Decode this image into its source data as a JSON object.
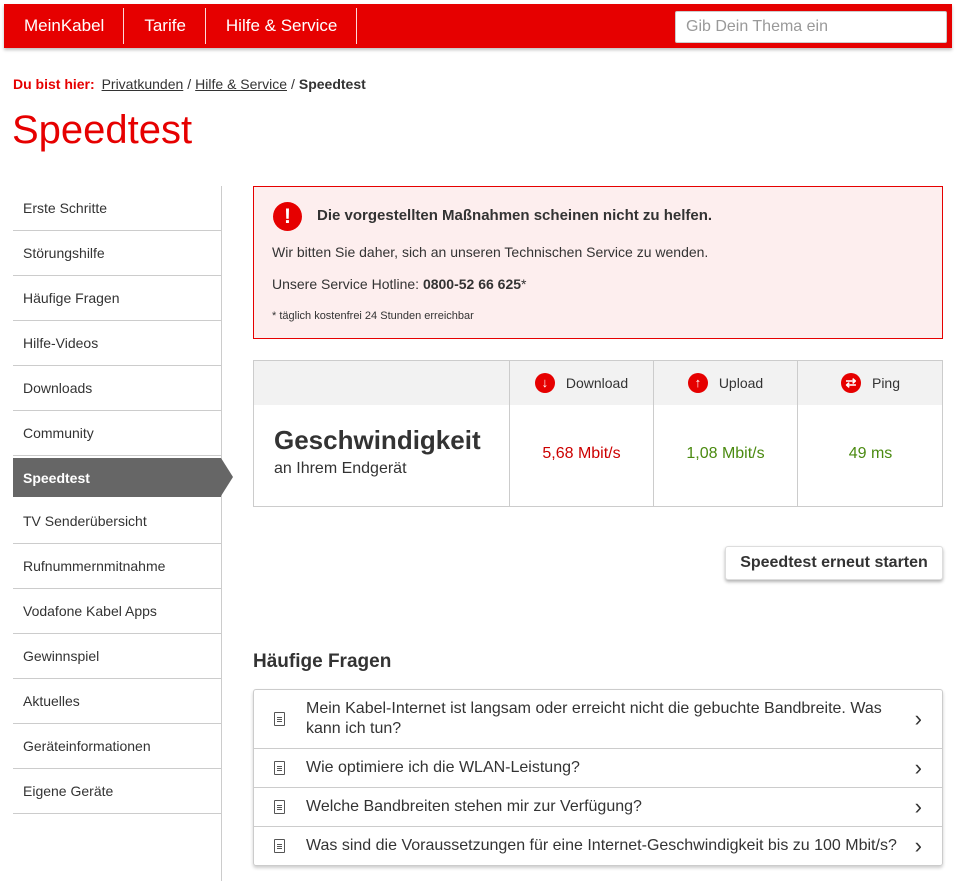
{
  "topnav": {
    "items": [
      "MeinKabel",
      "Tarife",
      "Hilfe & Service"
    ],
    "search_placeholder": "Gib Dein Thema ein"
  },
  "breadcrumb": {
    "label": "Du bist hier:",
    "items": [
      "Privatkunden",
      "Hilfe & Service"
    ],
    "current": "Speedtest"
  },
  "page_title": "Speedtest",
  "sidebar": {
    "items": [
      "Erste Schritte",
      "Störungshilfe",
      "Häufige Fragen",
      "Hilfe-Videos",
      "Downloads",
      "Community",
      "Speedtest",
      "TV Senderübersicht",
      "Rufnummernmitnahme",
      "Vodafone Kabel Apps",
      "Gewinnspiel",
      "Aktuelles",
      "Geräteinformationen",
      "Eigene Geräte"
    ],
    "active": "Speedtest"
  },
  "alert": {
    "title": "Die vorgestellten Maßnahmen scheinen nicht zu helfen.",
    "line1": "Wir bitten Sie daher, sich an unseren Technischen Service zu wenden.",
    "hotline_label": "Unsere Service Hotline:",
    "hotline_number": "0800-52 66 625",
    "hotline_suffix": "*",
    "footnote": "* täglich kostenfrei 24 Stunden erreichbar"
  },
  "speedtest": {
    "label_big": "Geschwindigkeit",
    "label_small": "an Ihrem Endgerät",
    "download_label": "Download",
    "upload_label": "Upload",
    "ping_label": "Ping",
    "download_value": "5,68 Mbit/s",
    "upload_value": "1,08 Mbit/s",
    "ping_value": "49 ms",
    "colors": {
      "download": "#cc0000",
      "upload": "#4a8a10",
      "ping": "#4a8a10"
    }
  },
  "restart_button": "Speedtest erneut starten",
  "faq": {
    "heading": "Häufige Fragen",
    "items": [
      "Mein Kabel-Internet ist langsam oder erreicht nicht die gebuchte Bandbreite. Was kann ich tun?",
      "Wie optimiere ich die WLAN-Leistung?",
      "Welche Bandbreiten stehen mir zur Verfügung?",
      "Was sind die Voraussetzungen für eine Internet-Geschwindigkeit bis zu 100 Mbit/s?"
    ]
  },
  "accent_color": "#e60000"
}
